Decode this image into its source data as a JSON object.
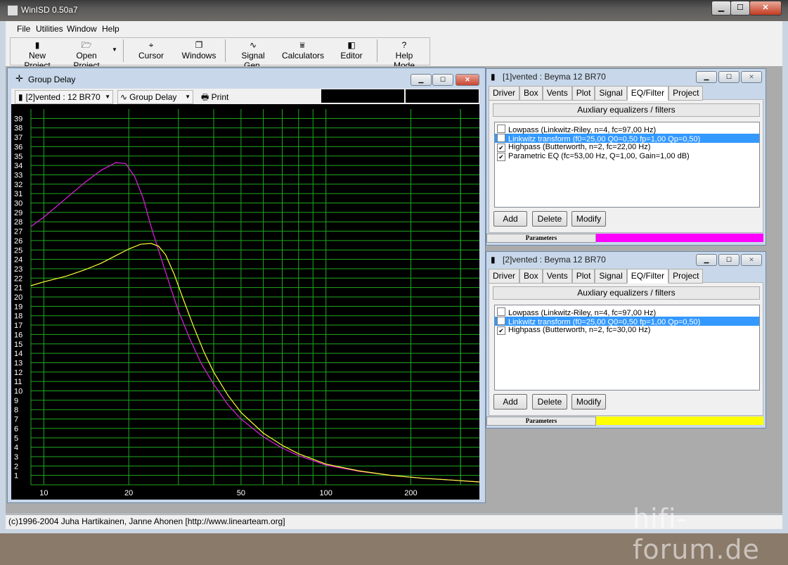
{
  "app": {
    "title": "WinISD 0.50a7"
  },
  "menu": [
    "File",
    "Utilities",
    "Window",
    "Help"
  ],
  "toolbar": {
    "new_project": "New Project",
    "open_project": "Open Project",
    "cursor": "Cursor",
    "windows": "Windows",
    "signal_gen": "Signal Gen.",
    "calculators": "Calculators",
    "editor": "Editor",
    "help_mode": "Help Mode"
  },
  "group_delay": {
    "title": "Group Delay",
    "project_select": "[2]vented : 12 BR70",
    "plot_select": "Group Delay",
    "print_label": "Print"
  },
  "chart_data": {
    "type": "line",
    "xscale": "log",
    "xlim": [
      9,
      350
    ],
    "ylim": [
      0,
      40
    ],
    "grid": true,
    "x_tick_labels": [
      "10",
      "20",
      "50",
      "100",
      "200"
    ],
    "x_ticks": [
      10,
      20,
      50,
      100,
      200
    ],
    "y_ticks": [
      1,
      2,
      3,
      4,
      5,
      6,
      7,
      8,
      9,
      10,
      11,
      12,
      13,
      14,
      15,
      16,
      17,
      18,
      19,
      20,
      21,
      22,
      23,
      24,
      25,
      26,
      27,
      28,
      29,
      30,
      31,
      32,
      33,
      34,
      35,
      36,
      37,
      38,
      39
    ],
    "series": [
      {
        "color": "#e020e0",
        "x": [
          9,
          10,
          12,
          14,
          16,
          18,
          19.5,
          21,
          22.5,
          24,
          26,
          28,
          30,
          33,
          36,
          40,
          45,
          50,
          60,
          70,
          80,
          100,
          130,
          170,
          220,
          280,
          350
        ],
        "y": [
          27.5,
          28.5,
          30.5,
          32.2,
          33.5,
          34.3,
          34.2,
          32.8,
          30.5,
          27.5,
          24.2,
          21.2,
          18.5,
          15.5,
          13.0,
          10.7,
          8.5,
          7.0,
          5.1,
          3.9,
          3.1,
          2.1,
          1.45,
          1.0,
          0.7,
          0.5,
          0.3
        ]
      },
      {
        "color": "#ffff33",
        "x": [
          9,
          10,
          12,
          14,
          16,
          18,
          20,
          22,
          24,
          25.5,
          27,
          29,
          31,
          34,
          37,
          40,
          45,
          50,
          60,
          70,
          80,
          100,
          130,
          170,
          220,
          280,
          350
        ],
        "y": [
          21.2,
          21.6,
          22.2,
          22.9,
          23.6,
          24.4,
          25.1,
          25.6,
          25.7,
          25.4,
          24.5,
          22.4,
          20.0,
          16.8,
          14.1,
          12.0,
          9.5,
          7.7,
          5.5,
          4.2,
          3.3,
          2.2,
          1.5,
          1.0,
          0.7,
          0.5,
          0.3
        ]
      }
    ]
  },
  "vented1": {
    "title": "[1]vented : Beyma 12 BR70",
    "tabs": [
      "Driver",
      "Box",
      "Vents",
      "Plot",
      "Signal",
      "EQ/Filter",
      "Project"
    ],
    "aux_label": "Auxliary equalizers / filters",
    "items": [
      {
        "label": "Lowpass (Linkwitz-Riley, n=4, fc=97,00 Hz)",
        "check": ""
      },
      {
        "label": "Linkwitz transform (f0=25,00 Q0=0,50 fp=1,00 Qp=0,50)",
        "check": ""
      },
      {
        "label": "Highpass (Butterworth, n=2, fc=22,00 Hz)",
        "check": "✔"
      },
      {
        "label": "Parametric EQ (fc=53,00 Hz, Q=1,00, Gain=1,00 dB)",
        "check": "✔"
      }
    ],
    "add": "Add",
    "delete": "Delete",
    "modify": "Modify",
    "params_label": "Parameters",
    "color": "#ff00ff"
  },
  "vented2": {
    "title": "[2]vented : Beyma 12 BR70",
    "tabs": [
      "Driver",
      "Box",
      "Vents",
      "Plot",
      "Signal",
      "EQ/Filter",
      "Project"
    ],
    "aux_label": "Auxliary equalizers / filters",
    "items": [
      {
        "label": "Lowpass (Linkwitz-Riley, n=4, fc=97,00 Hz)",
        "check": ""
      },
      {
        "label": "Linkwitz transform (f0=25,00 Q0=0,50 fp=1,00 Qp=0,50)",
        "check": ""
      },
      {
        "label": "Highpass (Butterworth, n=2, fc=30,00 Hz)",
        "check": "✔"
      }
    ],
    "add": "Add",
    "delete": "Delete",
    "modify": "Modify",
    "params_label": "Parameters",
    "color": "#ffff00"
  },
  "status": {
    "text": "(c)1996-2004 Juha Hartikainen, Janne Ahonen [http://www.linearteam.org]"
  },
  "watermark": "hifi-forum.de"
}
